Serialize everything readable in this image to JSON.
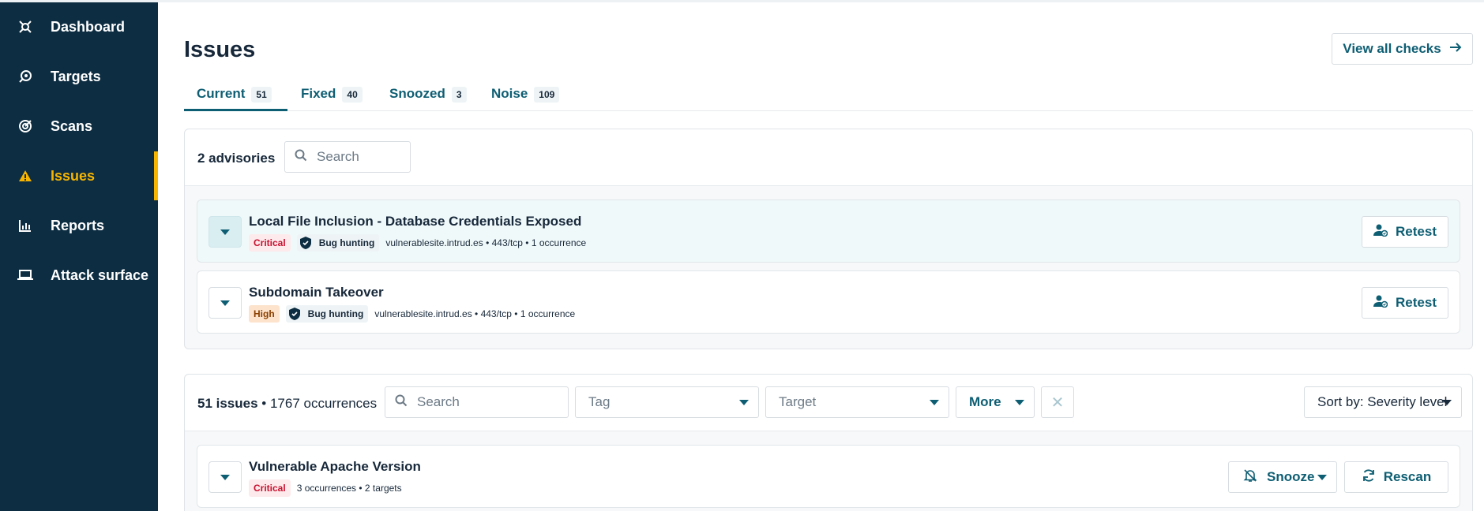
{
  "sidebar": {
    "items": [
      {
        "label": "Dashboard",
        "icon": "dashboard-icon",
        "active": false
      },
      {
        "label": "Targets",
        "icon": "target-icon",
        "active": false
      },
      {
        "label": "Scans",
        "icon": "scan-icon",
        "active": false
      },
      {
        "label": "Issues",
        "icon": "warning-icon",
        "active": true
      },
      {
        "label": "Reports",
        "icon": "bar-chart-icon",
        "active": false
      },
      {
        "label": "Attack surface",
        "icon": "laptop-icon",
        "active": false
      }
    ],
    "active_color": "#f7b500",
    "background": "#0d2d42"
  },
  "page": {
    "title": "Issues",
    "view_all_label": "View all checks"
  },
  "tabs": [
    {
      "label": "Current",
      "count": "51",
      "active": true
    },
    {
      "label": "Fixed",
      "count": "40",
      "active": false
    },
    {
      "label": "Snoozed",
      "count": "3",
      "active": false
    },
    {
      "label": "Noise",
      "count": "109",
      "active": false
    }
  ],
  "advisories": {
    "count_label": "2 advisories",
    "search_placeholder": "Search",
    "items": [
      {
        "title": "Local File Inclusion - Database Credentials Exposed",
        "severity": "Critical",
        "tag": "Bug hunting",
        "meta": "vulnerablesite.intrud.es • 443/tcp • 1 occurrence",
        "action": "Retest",
        "highlighted": true
      },
      {
        "title": "Subdomain Takeover",
        "severity": "High",
        "tag": "Bug hunting",
        "meta": "vulnerablesite.intrud.es • 443/tcp • 1 occurrence",
        "action": "Retest",
        "highlighted": false
      }
    ]
  },
  "issues": {
    "count_label": "51 issues",
    "occurrences_label": "• 1767 occurrences",
    "search_placeholder": "Search",
    "tag_label": "Tag",
    "target_label": "Target",
    "more_label": "More",
    "clear_label": "✕",
    "sort_label": "Sort by: Severity level",
    "items": [
      {
        "title": "Vulnerable Apache Version",
        "severity": "Critical",
        "meta": "3 occurrences • 2 targets",
        "snooze_label": "Snooze",
        "rescan_label": "Rescan"
      }
    ]
  },
  "colors": {
    "accent": "#0e5e73",
    "critical": "#c8102e",
    "high": "#8a3f00"
  }
}
